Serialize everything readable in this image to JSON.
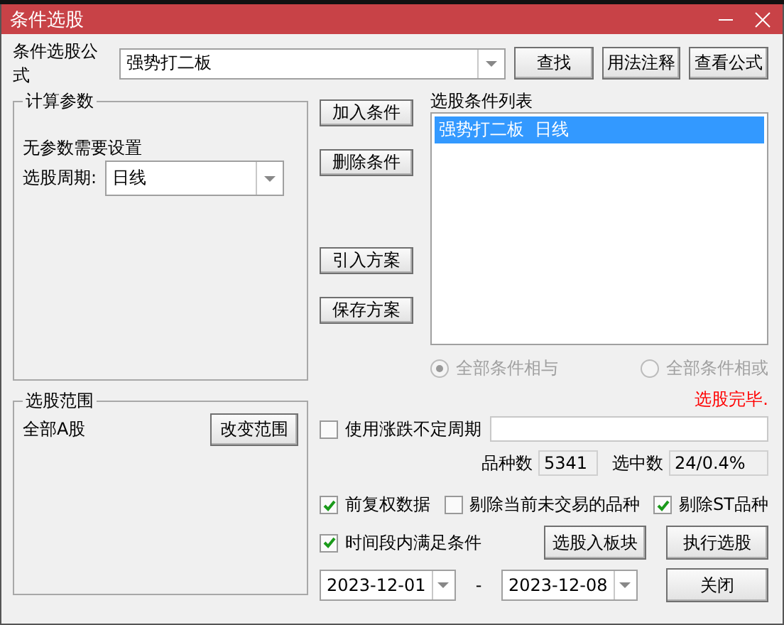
{
  "window": {
    "title": "条件选股"
  },
  "formula": {
    "label": "条件选股公式",
    "value": "强势打二板"
  },
  "top_buttons": [
    "查找",
    "用法注释",
    "查看公式"
  ],
  "params_group": {
    "title": "计算参数",
    "message": "无参数需要设置",
    "period_label": "选股周期:",
    "period_value": "日线"
  },
  "middle_buttons": [
    "加入条件",
    "删除条件",
    "引入方案",
    "保存方案"
  ],
  "condition_list": {
    "title": "选股条件列表",
    "items": [
      {
        "label": "强势打二板  日线",
        "selected": true
      }
    ]
  },
  "logic_options": [
    {
      "label": "全部条件相与",
      "selected": true,
      "disabled": true
    },
    {
      "label": "全部条件相或",
      "selected": false,
      "disabled": true
    }
  ],
  "status": "选股完毕.",
  "variable_period": {
    "label": "使用涨跌不定周期",
    "checked": false
  },
  "counts": [
    {
      "label": "品种数",
      "value": "5341"
    },
    {
      "label": "选中数",
      "value": "24/0.4%"
    }
  ],
  "options": [
    {
      "label": "前复权数据",
      "checked": true
    },
    {
      "label": "剔除当前未交易的品种",
      "checked": false
    },
    {
      "label": "剔除ST品种",
      "checked": true
    }
  ],
  "range_group": {
    "title": "选股范围",
    "value": "全部A股",
    "button": "改变范围"
  },
  "time_condition": {
    "label": "时间段内满足条件",
    "checked": true
  },
  "date_range": {
    "start": "2023-12-01",
    "separator": "-",
    "end": "2023-12-08"
  },
  "action_buttons": [
    "选股入板块",
    "执行选股",
    "关闭"
  ]
}
